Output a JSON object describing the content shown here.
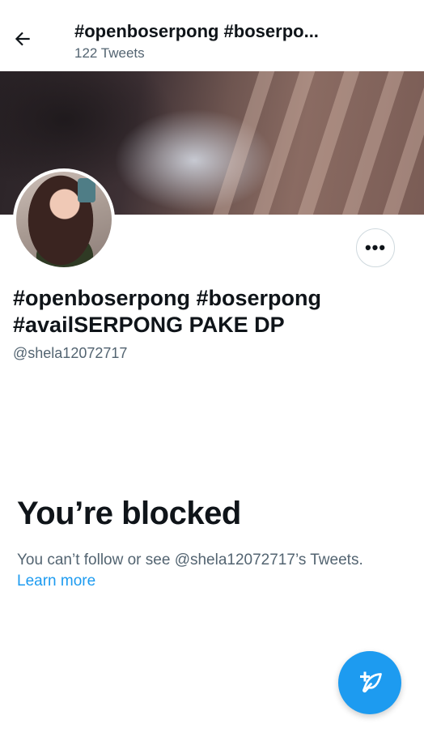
{
  "header": {
    "title": "#openboserpong #boserpo...",
    "subtitle": "122 Tweets"
  },
  "profile": {
    "name": "#openboserpong #boserpong #availSERPONG PAKE DP",
    "handle": "@shela12072717"
  },
  "blocked": {
    "title": "You’re blocked",
    "description": "You can’t follow or see @shela12072717’s Tweets.",
    "learn_more": "Learn more"
  },
  "colors": {
    "accent": "#1d9bf0",
    "secondary_text": "#536471",
    "primary_text": "#0f1419"
  },
  "icons": {
    "back": "arrow-left-icon",
    "more": "more-horizontal-icon",
    "compose": "compose-tweet-icon"
  }
}
